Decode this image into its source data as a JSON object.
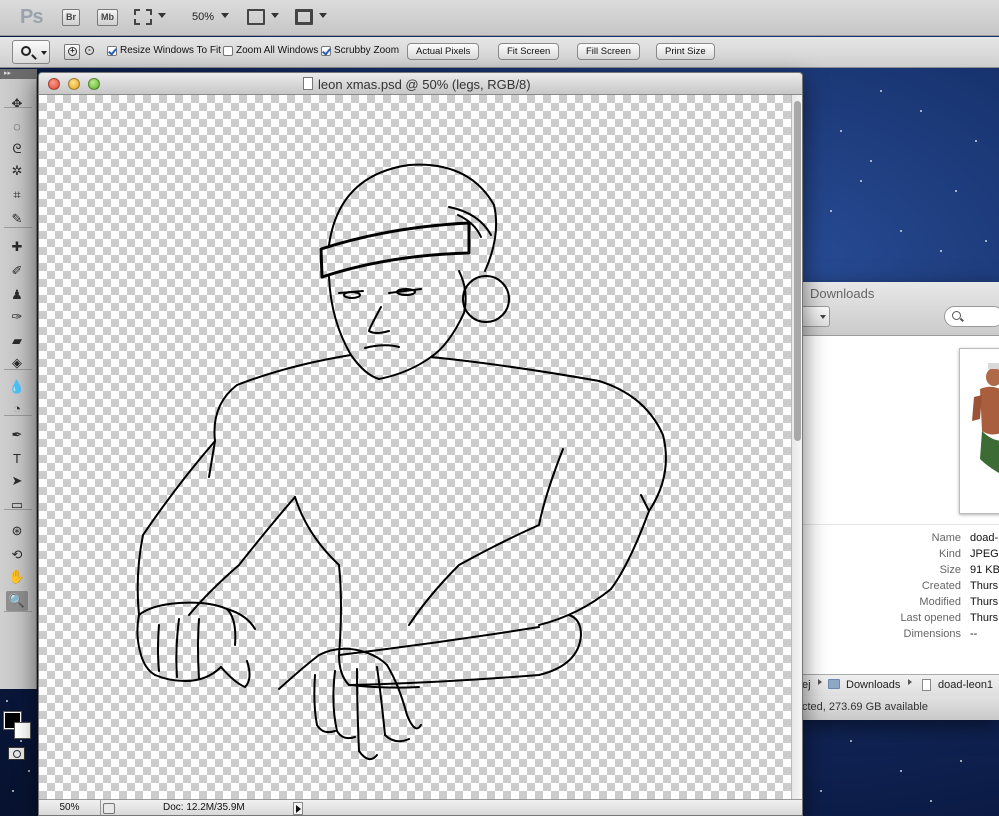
{
  "appbar": {
    "logo": "Ps",
    "bridge_label": "Br",
    "minibridge_label": "Mb",
    "zoom_level": "50%"
  },
  "options_bar": {
    "resize_windows_label": "Resize Windows To Fit",
    "resize_windows_checked": true,
    "zoom_all_label": "Zoom All Windows",
    "zoom_all_checked": false,
    "scrubby_zoom_label": "Scrubby Zoom",
    "scrubby_zoom_checked": true,
    "actual_pixels_label": "Actual Pixels",
    "fit_screen_label": "Fit Screen",
    "fill_screen_label": "Fill Screen",
    "print_size_label": "Print Size"
  },
  "tools": [
    {
      "name": "move-tool-icon",
      "glyph": "✥"
    },
    {
      "name": "marquee-tool-icon",
      "glyph": "◌"
    },
    {
      "name": "lasso-tool-icon",
      "glyph": "ᘓ"
    },
    {
      "name": "quick-select-tool-icon",
      "glyph": "✲"
    },
    {
      "name": "crop-tool-icon",
      "glyph": "⌗"
    },
    {
      "name": "eyedropper-tool-icon",
      "glyph": "✎"
    },
    {
      "name": "healing-brush-tool-icon",
      "glyph": "✚"
    },
    {
      "name": "brush-tool-icon",
      "glyph": "✐"
    },
    {
      "name": "clone-stamp-tool-icon",
      "glyph": "♟"
    },
    {
      "name": "history-brush-tool-icon",
      "glyph": "✑"
    },
    {
      "name": "eraser-tool-icon",
      "glyph": "▰"
    },
    {
      "name": "paint-bucket-tool-icon",
      "glyph": "◈"
    },
    {
      "name": "blur-tool-icon",
      "glyph": "💧"
    },
    {
      "name": "dodge-tool-icon",
      "glyph": "◔"
    },
    {
      "name": "pen-tool-icon",
      "glyph": "✒"
    },
    {
      "name": "type-tool-icon",
      "glyph": "T"
    },
    {
      "name": "path-select-tool-icon",
      "glyph": "➤"
    },
    {
      "name": "rectangle-tool-icon",
      "glyph": "▭"
    },
    {
      "name": "3d-rotate-tool-icon",
      "glyph": "⊛"
    },
    {
      "name": "3d-orbit-tool-icon",
      "glyph": "⟲"
    },
    {
      "name": "hand-tool-icon",
      "glyph": "✋"
    },
    {
      "name": "zoom-tool-icon",
      "glyph": "🔍"
    }
  ],
  "colors": {
    "foreground": "#000000",
    "background": "#ffffff"
  },
  "document": {
    "title": "leon xmas.psd @ 50% (legs, RGB/8)",
    "zoom": "50%",
    "doc_info": "Doc: 12.2M/35.9M"
  },
  "finder": {
    "title": "Downloads",
    "info": [
      {
        "label": "Name",
        "value": "doad-"
      },
      {
        "label": "Kind",
        "value": "JPEG i"
      },
      {
        "label": "Size",
        "value": "91 KB"
      },
      {
        "label": "Created",
        "value": "Thurs"
      },
      {
        "label": "Modified",
        "value": "Thurs"
      },
      {
        "label": "Last opened",
        "value": "Thurs"
      },
      {
        "label": "Dimensions",
        "value": "--"
      }
    ],
    "path": {
      "prefix": "ej",
      "folder": "Downloads",
      "file": "doad-leon1"
    },
    "status": "cted, 273.69 GB available"
  }
}
